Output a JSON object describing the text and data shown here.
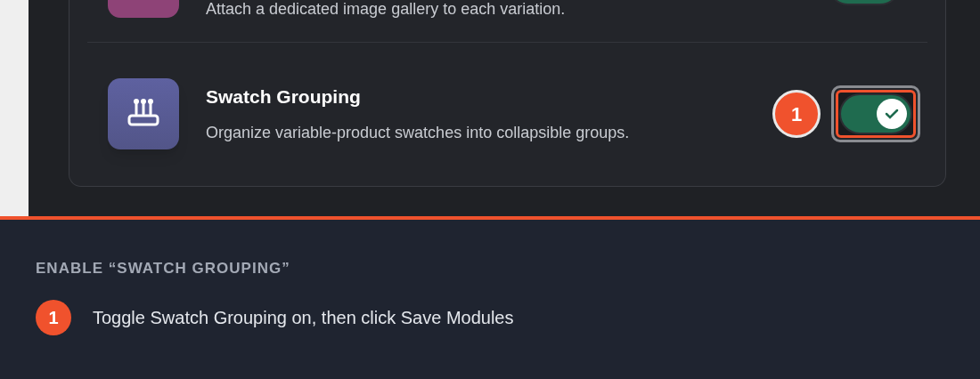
{
  "modules": [
    {
      "description": "Attach a dedicated image gallery to each variation.",
      "enabled": true,
      "color": "#8e4377"
    },
    {
      "title": "Swatch Grouping",
      "description": "Organize variable-product swatches into collapsible groups.",
      "enabled": true,
      "color": "#5e61a0",
      "highlighted": true,
      "callout": "1"
    }
  ],
  "instruction": {
    "heading": "ENABLE “SWATCH GROUPING”",
    "steps": [
      {
        "number": "1",
        "text": "Toggle Swatch Grouping on, then click Save Modules"
      }
    ]
  }
}
